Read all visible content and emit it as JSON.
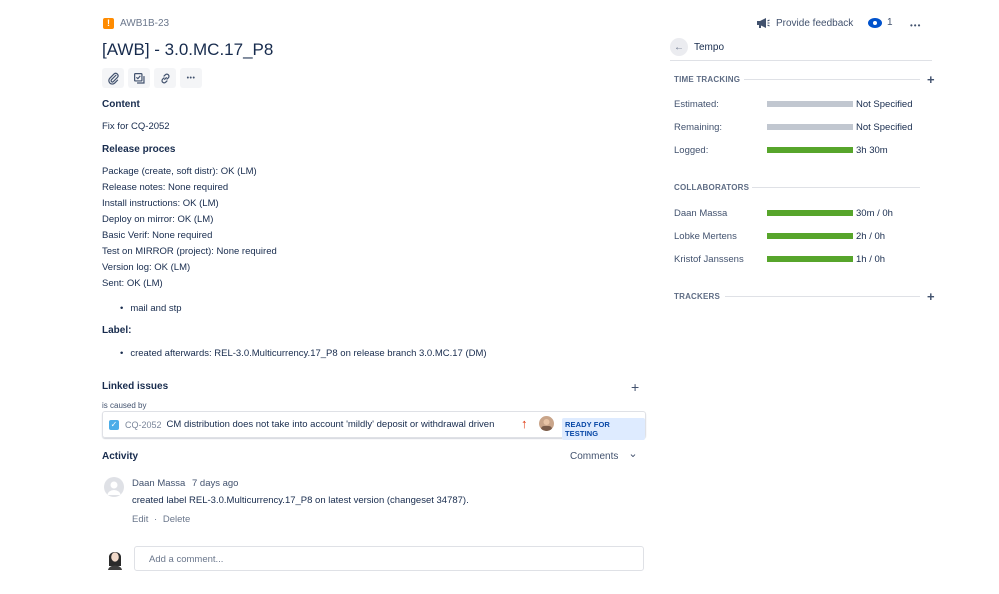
{
  "issue": {
    "key": "AWB1B-23",
    "type_glyph": "!",
    "title": "[AWB] - 3.0.MC.17_P8"
  },
  "toolbar": {
    "icons": [
      "attach-icon",
      "subtask-icon",
      "link-icon",
      "more-icon"
    ],
    "more_glyph": "•••"
  },
  "description": {
    "content_head": "Content",
    "content_text": "Fix for CQ-2052",
    "release_head": "Release proces",
    "release_lines": [
      "Package (create, soft distr): OK (LM)",
      "Release notes: None required",
      "Install instructions: OK (LM)",
      "Deploy on mirror: OK (LM)",
      "Basic Verif: None required",
      "Test on MIRROR (project): None required",
      "Version log: OK (LM)",
      "Sent: OK (LM)"
    ],
    "release_bullet": "mail and stp",
    "label_head": "Label:",
    "label_bullet": "created afterwards: REL-3.0.Multicurrency.17_P8 on release branch 3.0.MC.17 (DM)"
  },
  "linked": {
    "heading": "Linked issues",
    "add_glyph": "+",
    "relation": "is caused by",
    "item": {
      "key": "CQ-2052",
      "summary": "CM distribution does not take into account 'mildly' deposit or withdrawal driven",
      "priority_glyph": "↑",
      "status": "READY FOR TESTING"
    }
  },
  "activity": {
    "heading": "Activity",
    "filter": "Comments",
    "filter_chevron": "⌄",
    "entry": {
      "author": "Daan Massa",
      "when": "7 days ago",
      "text": "created label REL-3.0.Multicurrency.17_P8 on latest version (changeset 34787).",
      "edit": "Edit",
      "separator": "·",
      "delete": "Delete"
    },
    "comment_placeholder": "Add a comment..."
  },
  "header_actions": {
    "feedback": "Provide feedback",
    "watch_count": "1",
    "more_glyph": "•••"
  },
  "tempo": {
    "back_glyph": "←",
    "title": "Tempo",
    "time_tracking": {
      "heading": "TIME TRACKING",
      "add_glyph": "+",
      "rows": [
        {
          "label": "Estimated:",
          "value": "Not Specified",
          "fill": 1.0,
          "color": "#c1c7d0"
        },
        {
          "label": "Remaining:",
          "value": "Not Specified",
          "fill": 1.0,
          "color": "#c1c7d0"
        },
        {
          "label": "Logged:",
          "value": "3h 30m",
          "fill": 1.0,
          "color": "#57a52b"
        }
      ]
    },
    "collaborators": {
      "heading": "COLLABORATORS",
      "rows": [
        {
          "label": "Daan Massa",
          "value": "30m / 0h",
          "fill": 1.0,
          "color": "#57a52b"
        },
        {
          "label": "Lobke Mertens",
          "value": "2h / 0h",
          "fill": 1.0,
          "color": "#57a52b"
        },
        {
          "label": "Kristof Janssens",
          "value": "1h / 0h",
          "fill": 1.0,
          "color": "#57a52b"
        }
      ]
    },
    "trackers": {
      "heading": "TRACKERS",
      "add_glyph": "+"
    }
  }
}
